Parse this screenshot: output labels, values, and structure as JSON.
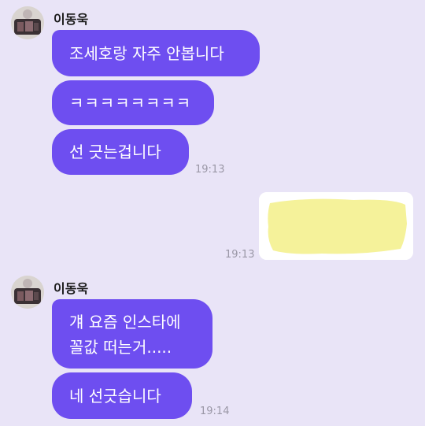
{
  "chat": {
    "messages_group_1": {
      "sender": "이동욱",
      "bubbles": [
        "조세호랑 자주 안봅니다",
        "ㅋㅋㅋㅋㅋㅋㅋㅋ",
        "선 긋는겁니다"
      ],
      "time": "19:13"
    },
    "my_message": {
      "time": "19:13"
    },
    "messages_group_2": {
      "sender": "이동욱",
      "bubbles": [
        "걔 요즘 인스타에\n꼴값 떠는거.....",
        "네 선긋습니다"
      ],
      "time": "19:14"
    }
  },
  "colors": {
    "background": "#e9e4f7",
    "bubble": "#6e4ef0",
    "highlight": "#f5f29a"
  }
}
